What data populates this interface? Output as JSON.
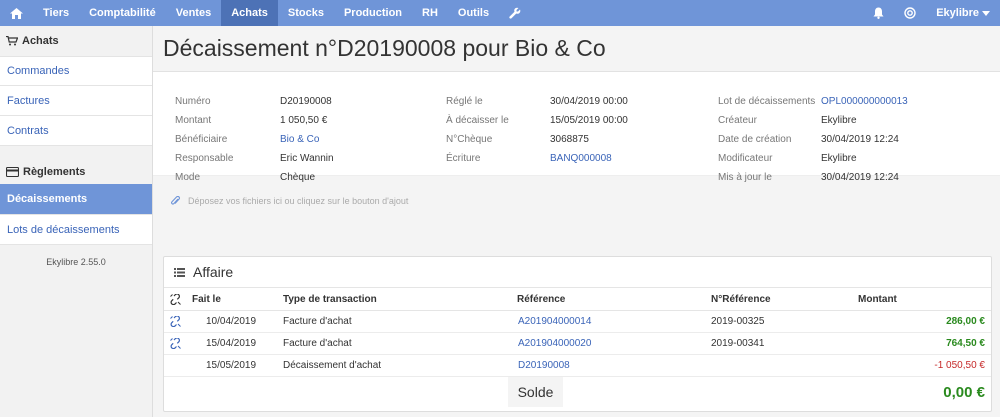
{
  "nav": {
    "items": [
      "Tiers",
      "Comptabilité",
      "Ventes",
      "Achats",
      "Stocks",
      "Production",
      "RH",
      "Outils"
    ],
    "active": "Achats",
    "user": "Ekylibre",
    "icons": [
      "home-icon",
      "wrench-icon",
      "bell-icon",
      "globe-icon"
    ]
  },
  "sidebar": {
    "achats_title": "Achats",
    "achats_links": [
      "Commandes",
      "Factures",
      "Contrats"
    ],
    "reglements_title": "Règlements",
    "reglements_links": [
      "Décaissements",
      "Lots de décaissements"
    ],
    "active": "Décaissements",
    "version": "Ekylibre 2.55.0"
  },
  "page": {
    "title": "Décaissement n°D20190008 pour Bio & Co"
  },
  "info": {
    "col1": [
      {
        "label": "Numéro",
        "value": "D20190008"
      },
      {
        "label": "Montant",
        "value": "1 050,50 €"
      },
      {
        "label": "Bénéficiaire",
        "value": "Bio & Co"
      },
      {
        "label": "Responsable",
        "value": "Eric Wannin"
      },
      {
        "label": "Mode",
        "value": "Chèque"
      }
    ],
    "col2": [
      {
        "label": "Réglé le",
        "value": "30/04/2019 00:00"
      },
      {
        "label": "À décaisser le",
        "value": "15/05/2019 00:00"
      },
      {
        "label": "N°Chèque",
        "value": "3068875"
      },
      {
        "label": "Écriture",
        "value": "BANQ000008"
      }
    ],
    "col3": [
      {
        "label": "Lot de décaissements",
        "value": "OPL000000000013"
      },
      {
        "label": "Créateur",
        "value": "Ekylibre"
      },
      {
        "label": "Date de création",
        "value": "30/04/2019 12:24"
      },
      {
        "label": "Modificateur",
        "value": "Ekylibre"
      },
      {
        "label": "Mis à jour le",
        "value": "30/04/2019 12:24"
      }
    ]
  },
  "dropzone": {
    "text": "Déposez vos fichiers ici ou cliquez sur le bouton d'ajout"
  },
  "affaire": {
    "title": "Affaire",
    "headers": {
      "date": "Fait le",
      "type": "Type de transaction",
      "ref": "Référence",
      "nref": "N°Référence",
      "amount": "Montant"
    },
    "rows": [
      {
        "date": "10/04/2019",
        "type": "Facture d'achat",
        "ref": "A201904000014",
        "nref": "2019-00325",
        "amount": "286,00 €"
      },
      {
        "date": "15/04/2019",
        "type": "Facture d'achat",
        "ref": "A201904000020",
        "nref": "2019-00341",
        "amount": "764,50 €"
      },
      {
        "date": "15/05/2019",
        "type": "Décaissement d'achat",
        "ref": "D20190008",
        "nref": "",
        "amount": "-1 050,50 €"
      }
    ],
    "solde_label": "Solde",
    "solde_value": "0,00 €"
  },
  "colors": {
    "nav_bg": "#6f95d8",
    "nav_active": "#4d72b6",
    "link": "#3a64b8",
    "positive": "#2a8a1e",
    "negative": "#c62828"
  }
}
